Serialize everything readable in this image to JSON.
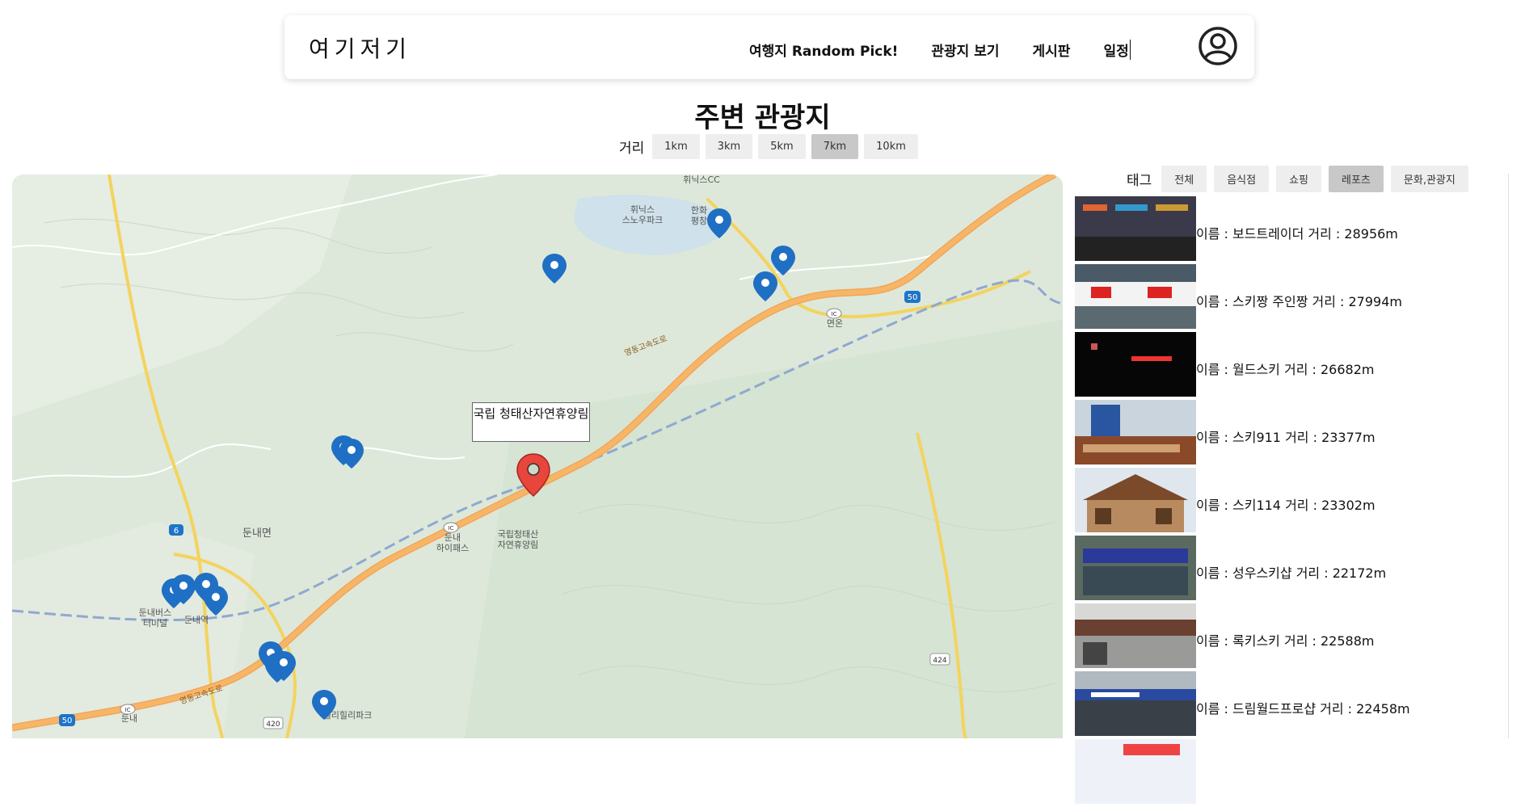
{
  "nav": {
    "brand": "여기저기",
    "links": [
      "여행지 Random Pick!",
      "관광지 보기",
      "게시판",
      "일정"
    ],
    "profile_icon": "user-circle-icon"
  },
  "page": {
    "title": "주변 관광지"
  },
  "distance": {
    "label": "거리",
    "options": [
      "1km",
      "3km",
      "5km",
      "7km",
      "10km"
    ],
    "selected": "7km"
  },
  "map": {
    "selected_info": "국립 청태산자연휴양림",
    "labels": {
      "ski": "휘닉스\n스노우파크",
      "hanwha": "한화\n평창",
      "cc": "휘닉스CC",
      "myeonon": "면온",
      "expressway1": "영동고속도로",
      "expressway2": "영동고속도로",
      "dundae": "둔내면",
      "hipass": "둔내\n하이패스",
      "forest": "국립청태산\n자연휴양림",
      "bus": "둔내버스\n터미널",
      "station": "둔내역",
      "dundae_ic": "둔내",
      "wellili": "웰리힐리파크",
      "route6": "6",
      "route50a": "50",
      "route50b": "50",
      "route420": "420",
      "route424": "424",
      "ic1": "IC",
      "ic2": "IC",
      "ic3": "IC"
    },
    "colors": {
      "selected_marker": "#e8453c",
      "marker": "#1f6fc4",
      "expressway": "#f7b667"
    }
  },
  "tags": {
    "label": "태그",
    "options": [
      "전체",
      "음식점",
      "쇼핑",
      "레포츠",
      "문화,관광지"
    ],
    "selected": "레포츠"
  },
  "results": [
    {
      "text": "이름 : 보드트레이더    거리 : 28956m"
    },
    {
      "text": "이름 : 스키짱 주인짱    거리 : 27994m"
    },
    {
      "text": "이름 : 월드스키    거리 : 26682m"
    },
    {
      "text": "이름 : 스키911    거리 : 23377m"
    },
    {
      "text": "이름 : 스키114    거리 : 23302m"
    },
    {
      "text": "이름 : 성우스키샵    거리 : 22172m"
    },
    {
      "text": "이름 : 록키스키    거리 : 22588m"
    },
    {
      "text": "이름 : 드림월드프로샵    거리 : 22458m"
    },
    {
      "text": ""
    }
  ]
}
